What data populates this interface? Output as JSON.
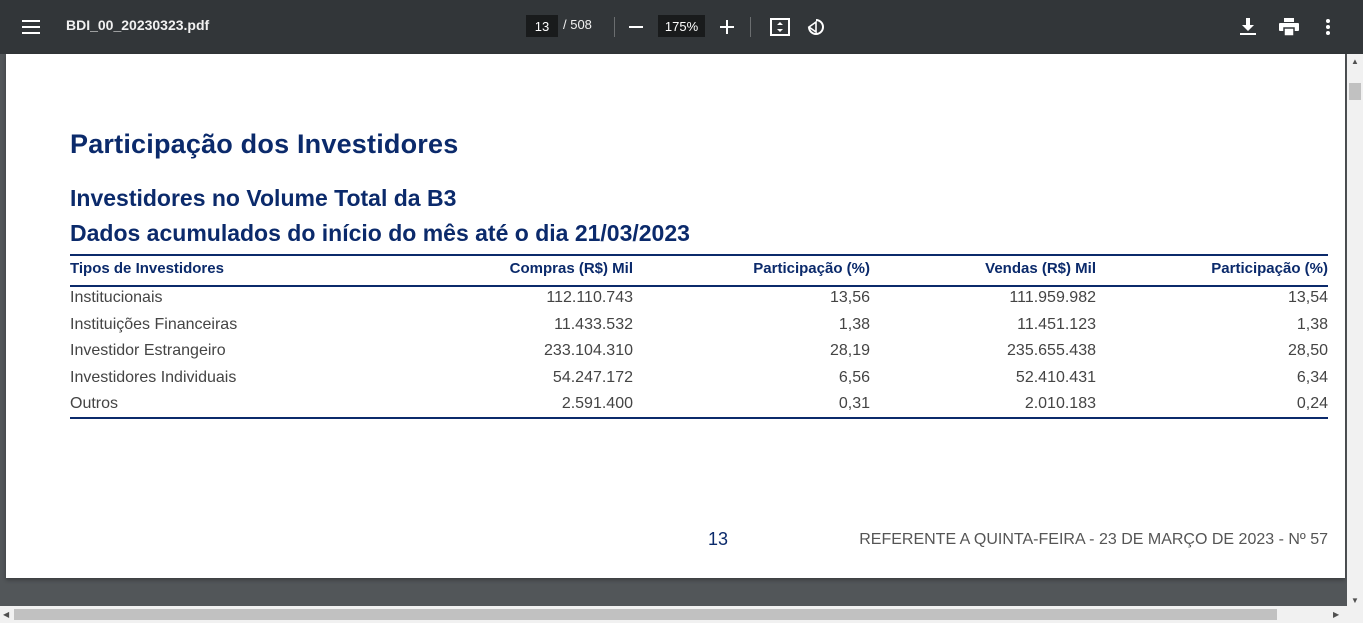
{
  "toolbar": {
    "filename": "BDI_00_20230323.pdf",
    "page_current": "13",
    "page_total": "/ 508",
    "zoom": "175%"
  },
  "doc": {
    "title": "Participação dos Investidores",
    "subtitle1": "Investidores no Volume Total da B3",
    "subtitle2": "Dados acumulados do início do mês até o dia 21/03/2023",
    "table": {
      "headers": [
        "Tipos de Investidores",
        "Compras (R$) Mil",
        "Participação (%)",
        "Vendas (R$) Mil",
        "Participação (%)"
      ],
      "rows": [
        [
          "Institucionais",
          "112.110.743",
          "13,56",
          "111.959.982",
          "13,54"
        ],
        [
          "Instituições Financeiras",
          "11.433.532",
          "1,38",
          "11.451.123",
          "1,38"
        ],
        [
          "Investidor Estrangeiro",
          "233.104.310",
          "28,19",
          "235.655.438",
          "28,50"
        ],
        [
          "Investidores Individuais",
          "54.247.172",
          "6,56",
          "52.410.431",
          "6,34"
        ],
        [
          "Outros",
          "2.591.400",
          "0,31",
          "2.010.183",
          "0,24"
        ]
      ]
    },
    "page_number": "13",
    "footer_ref": "REFERENTE A QUINTA-FEIRA - 23 DE MARÇO DE 2023 - Nº 57"
  },
  "icons": [
    "menu-icon",
    "zoom-out-icon",
    "zoom-in-icon",
    "fit-page-icon",
    "rotate-icon",
    "download-icon",
    "print-icon",
    "more-icon"
  ]
}
